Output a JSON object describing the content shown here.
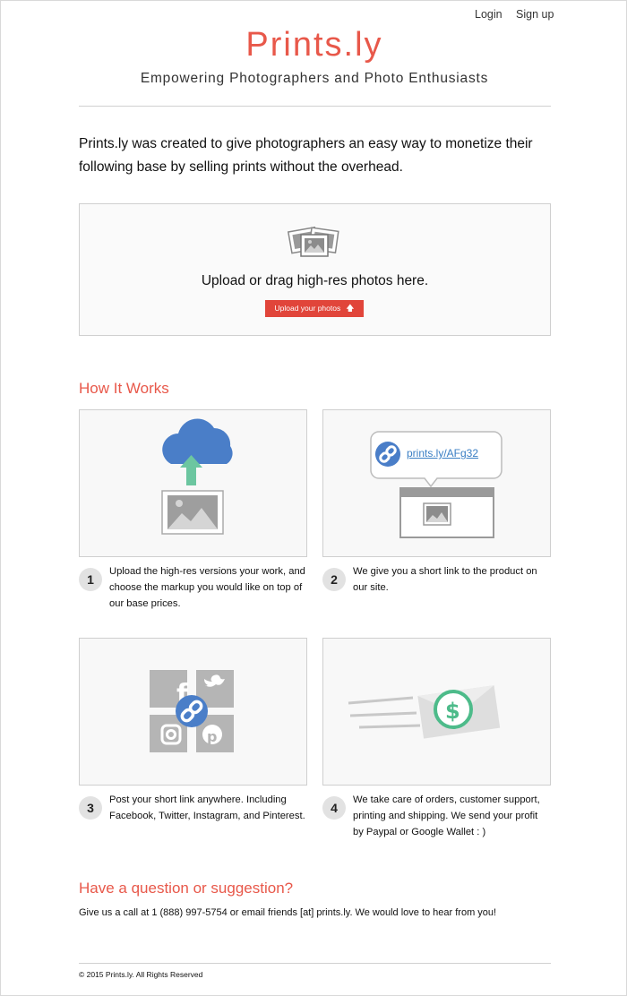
{
  "nav": {
    "login": "Login",
    "signup": "Sign up"
  },
  "header": {
    "logo": "Prints.ly",
    "tagline": "Empowering Photographers and Photo Enthusiasts"
  },
  "intro": "Prints.ly was created to give photographers an easy way to monetize their following base by selling prints without the overhead.",
  "upload": {
    "text": "Upload or drag high-res photos here.",
    "button": "Upload your photos"
  },
  "how": {
    "title": "How It Works",
    "short_link": "prints.ly/AFg32",
    "steps": [
      {
        "num": "1",
        "text": "Upload the high-res versions your work, and choose the markup you would like on top of our base prices."
      },
      {
        "num": "2",
        "text": "We give you a short link to the product on our site."
      },
      {
        "num": "3",
        "text": "Post your short link anywhere. Including Facebook, Twitter, Instagram, and Pinterest."
      },
      {
        "num": "4",
        "text": "We take care of orders, customer support, printing and shipping. We send your profit by Paypal or Google Wallet : )"
      }
    ]
  },
  "contact": {
    "title": "Have a question or suggestion?",
    "text": "Give us a call at 1 (888) 997-5754 or email friends [at] prints.ly. We would love to hear from you!"
  },
  "footer": "© 2015 Prints.ly. All Rights Reserved",
  "colors": {
    "accent": "#e8584a",
    "button": "#e1453a",
    "cloud": "#4a7ec8",
    "arrow_green": "#6cc6a0",
    "dollar_green": "#4dbb8a"
  }
}
